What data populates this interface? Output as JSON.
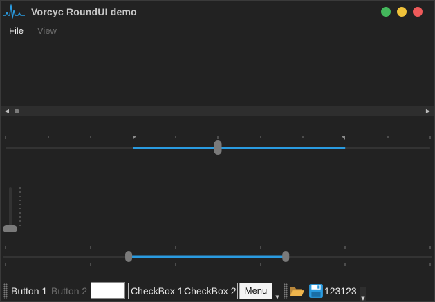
{
  "window": {
    "title": "Vorcyc RoundUI demo",
    "buttons": {
      "minimize_color": "#44b85c",
      "maximize_color": "#f0c23a",
      "close_color": "#ef5a5a"
    }
  },
  "menubar": {
    "items": [
      {
        "label": "File",
        "enabled": true
      },
      {
        "label": "View",
        "enabled": false
      }
    ]
  },
  "range_slider_top": {
    "min": 0,
    "max": 100,
    "low": 30,
    "value": 50,
    "high": 80,
    "accent": "#2a9be0"
  },
  "vertical_slider": {
    "min": 0,
    "max": 100,
    "value": 0
  },
  "range_slider_bottom": {
    "min": 0,
    "max": 100,
    "low": 29,
    "high": 66,
    "accent": "#2a9be0"
  },
  "toolbar": {
    "button1_label": "Button 1",
    "button2_label": "Button 2",
    "textbox_value": "",
    "checkbox1_label": "CheckBox 1",
    "checkbox2_label": "CheckBox 2",
    "menu_label": "Menu",
    "open_icon": "folder-open-icon",
    "save_icon": "floppy-save-icon",
    "spin_value": "123123"
  }
}
